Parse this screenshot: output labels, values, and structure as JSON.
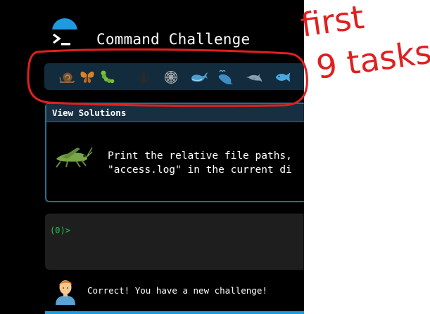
{
  "app": {
    "title": "Command Challenge",
    "logo_icon": "terminal-icon",
    "accent_color": "#1e9be0"
  },
  "tasks": [
    {
      "icon": "snail-icon"
    },
    {
      "icon": "butterfly-icon"
    },
    {
      "icon": "caterpillar-icon"
    },
    {
      "icon": "ant-icon"
    },
    {
      "icon": "spider-web-icon"
    },
    {
      "icon": "whale-icon"
    },
    {
      "icon": "spouting-whale-icon"
    },
    {
      "icon": "dolphin-icon"
    },
    {
      "icon": "fish-icon"
    }
  ],
  "solutions": {
    "header": "View Solutions",
    "icon": "cricket-icon",
    "prompt_line1": "Print the relative file paths,",
    "prompt_line2": "\"access.log\" in the current di"
  },
  "terminal": {
    "prompt": "(0)>"
  },
  "status": {
    "avatar_icon": "person-icon",
    "message": "Correct! You have a new challenge!"
  },
  "annotation": {
    "text_line1": "first",
    "text_line2": "9 tasks",
    "color": "#e02020"
  }
}
